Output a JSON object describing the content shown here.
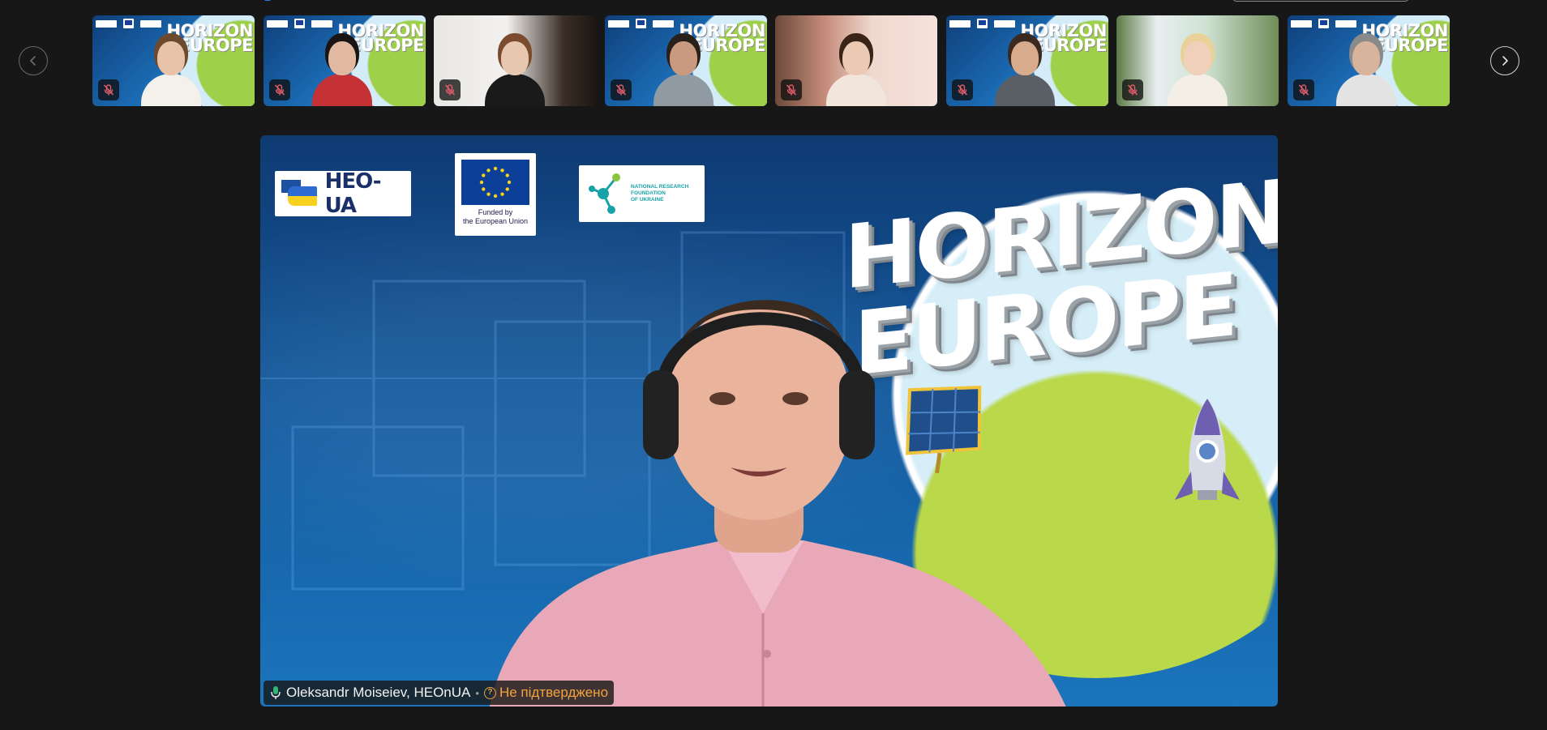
{
  "carousel": {
    "prev_icon": "chevron-left-icon",
    "next_icon": "chevron-right-icon"
  },
  "thumbnails": [
    {
      "background": "horizon",
      "mini_title": [
        "HORIZON",
        "EUROPE"
      ],
      "muted": true,
      "skin": "#e8c2a9",
      "hair": "#6b4a2e",
      "shirt": "#f4f1ea"
    },
    {
      "background": "horizon",
      "mini_title": [
        "HORIZON",
        "EUROPE"
      ],
      "muted": true,
      "skin": "#e0b9a0",
      "hair": "#1a1412",
      "shirt": "#c53236"
    },
    {
      "background": "room1",
      "muted": true,
      "skin": "#e8c7b1",
      "hair": "#7a4b2c",
      "shirt": "#1a1a1a"
    },
    {
      "background": "horizon",
      "mini_title": [
        "HORIZON",
        "EUROPE"
      ],
      "muted": true,
      "skin": "#c99a80",
      "hair": "#2a201a",
      "shirt": "#8f9aa3"
    },
    {
      "background": "room2",
      "muted": true,
      "skin": "#ecc9b5",
      "hair": "#3a2418",
      "shirt": "#f2e6dc"
    },
    {
      "background": "horizon",
      "mini_title": [
        "HORIZON",
        "EUROPE"
      ],
      "muted": true,
      "skin": "#d9ab8d",
      "hair": "#3b2a1f",
      "shirt": "#5a5f66"
    },
    {
      "background": "room3",
      "muted": true,
      "skin": "#f0d0bb",
      "hair": "#e8d29a",
      "shirt": "#f3eee6"
    },
    {
      "background": "horizon",
      "mini_title": [
        "HORIZON",
        "EUROPE"
      ],
      "muted": true,
      "skin": "#d8b49c",
      "hair": "#8a8a8a",
      "shirt": "#e3e3e3"
    }
  ],
  "stage": {
    "logos": {
      "heo": "HEO-UA",
      "eu_line1": "Funded by",
      "eu_line2": "the European Union",
      "nrf_line1": "NATIONAL RESEARCH",
      "nrf_line2": "FOUNDATION",
      "nrf_line3": "OF UKRAINE"
    },
    "title_line1": "HORIZON",
    "title_line2": "EUROPE",
    "speaker_name": "Oleksandr Moiseiev, HEOnUA",
    "separator": "•",
    "status_text": "Не підтверджено",
    "status_icon": "question-circle-icon",
    "mic_icon": "microphone-active-icon",
    "status_color": "#f2a33a"
  }
}
